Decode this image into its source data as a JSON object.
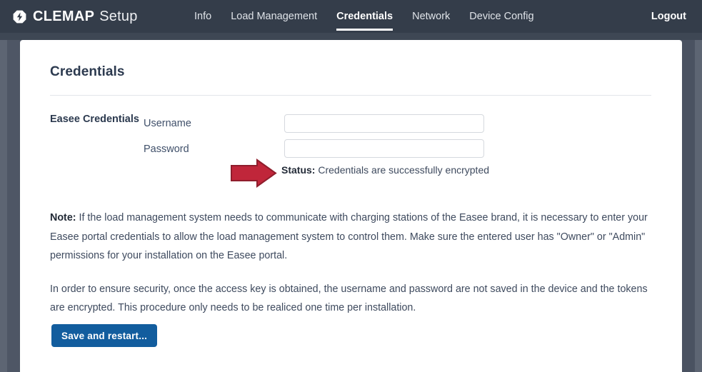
{
  "navbar": {
    "brand_icon": "lightning-bolt-hexagon-icon",
    "brand_name": "CLEMAP",
    "brand_sub": "Setup",
    "links": [
      {
        "label": "Info",
        "active": false
      },
      {
        "label": "Load Management",
        "active": false
      },
      {
        "label": "Credentials",
        "active": true
      },
      {
        "label": "Network",
        "active": false
      },
      {
        "label": "Device Config",
        "active": false
      }
    ],
    "logout_label": "Logout",
    "background_color": "#343d4a",
    "active_underline_color": "#ffffff"
  },
  "page": {
    "title": "Credentials",
    "background_color": "#4e5665",
    "card_color": "#ffffff"
  },
  "form": {
    "section_label": "Easee Credentials",
    "username": {
      "label": "Username",
      "value": "",
      "placeholder": ""
    },
    "password": {
      "label": "Password",
      "value": "",
      "placeholder": ""
    },
    "status": {
      "label": "Status:",
      "message": "Credentials are successfully encrypted"
    }
  },
  "annotation": {
    "arrow_name": "red-right-arrow-annotation",
    "fill_color": "#c0263a",
    "stroke_color": "#8f1d2c"
  },
  "notes": {
    "note_prefix": "Note:",
    "note_text": " If the load management system needs to communicate with charging stations of the Easee brand, it is necessary to enter your Easee portal credentials to allow the load management system to control them. Make sure the entered user has \"Owner\" or \"Admin\" permissions for your installation on the Easee portal.",
    "second_paragraph": "In order to ensure security, once the access key is obtained, the username and password are not saved in the device and the tokens are encrypted. This procedure only needs to be realiced one time per installation."
  },
  "actions": {
    "save_label": "Save and restart...",
    "save_color": "#125d9e"
  }
}
